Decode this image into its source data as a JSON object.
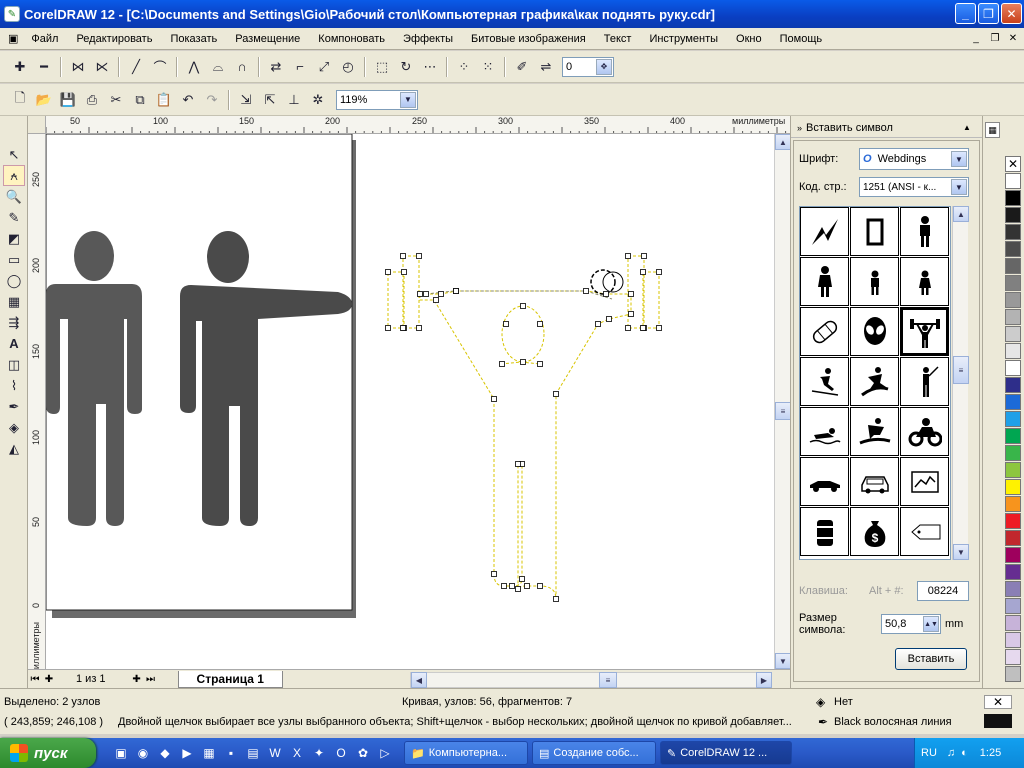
{
  "window": {
    "title": "CorelDRAW 12 - [C:\\Documents and Settings\\Gio\\Рабочий стол\\Компьютерная графика\\как поднять руку.cdr]",
    "app_icon": "coreldraw-icon"
  },
  "menu": {
    "items": [
      "Файл",
      "Редактировать",
      "Показать",
      "Размещение",
      "Компоновать",
      "Эффекты",
      "Битовые изображения",
      "Текст",
      "Инструменты",
      "Окно",
      "Помощь"
    ]
  },
  "property_bar": {
    "node_field_value": "0"
  },
  "standard_bar": {
    "zoom_value": "119%"
  },
  "rulers": {
    "unit_label": "миллиметры",
    "h_ticks": [
      "50",
      "100",
      "150",
      "200",
      "250",
      "300",
      "350",
      "400"
    ],
    "v_ticks": [
      "250",
      "200",
      "150",
      "100",
      "50",
      "0"
    ]
  },
  "page_nav": {
    "page_counter": "1 из 1",
    "page_tab": "Страница 1"
  },
  "docker": {
    "title": "Вставить символ",
    "font_label": "Шрифт:",
    "font_value": "Webdings",
    "codepage_label": "Код. стр.:",
    "codepage_value": "1251  (ANSI - к...",
    "key_label": "Клавиша:",
    "key_hint": "Alt + #:",
    "key_value": "08224",
    "size_label": "Размер символа:",
    "size_value": "50,8",
    "size_unit": "mm",
    "insert_button": "Вставить"
  },
  "status": {
    "selected": "Выделено: 2 узлов",
    "curve_info": "Кривая, узлов: 56, фрагментов: 7",
    "coords": "( 243,859; 246,108 )",
    "hint": "Двойной щелчок выбирает все узлы выбранного объекта; Shift+щелчок - выбор нескольких; двойной щелчок по кривой добавляет...",
    "fill_label": "Нет",
    "outline_label": "Black  волосяная линия"
  },
  "taskbar": {
    "start_label": "пуск",
    "tasks": [
      "Компьютерна...",
      "Создание собс...",
      "CorelDRAW 12 ..."
    ],
    "lang": "RU",
    "clock": "1:25"
  },
  "palette": [
    "#ffffff",
    "#000000",
    "#1a1a1a",
    "#333333",
    "#4d4d4d",
    "#666666",
    "#808080",
    "#999999",
    "#b3b3b3",
    "#cccccc",
    "#e6e6e6",
    "#ffffff",
    "#2e2e8a",
    "#1c6ad8",
    "#1fa0e8",
    "#00a651",
    "#39b54a",
    "#8dc63f",
    "#fff200",
    "#f7941d",
    "#ed1c24",
    "#c1272d",
    "#9e005d",
    "#662d91",
    "#8a7fb5",
    "#a6a6d0",
    "#c7b3d9",
    "#d9c8e6",
    "#e6d9ee",
    "#bfbfbf"
  ]
}
